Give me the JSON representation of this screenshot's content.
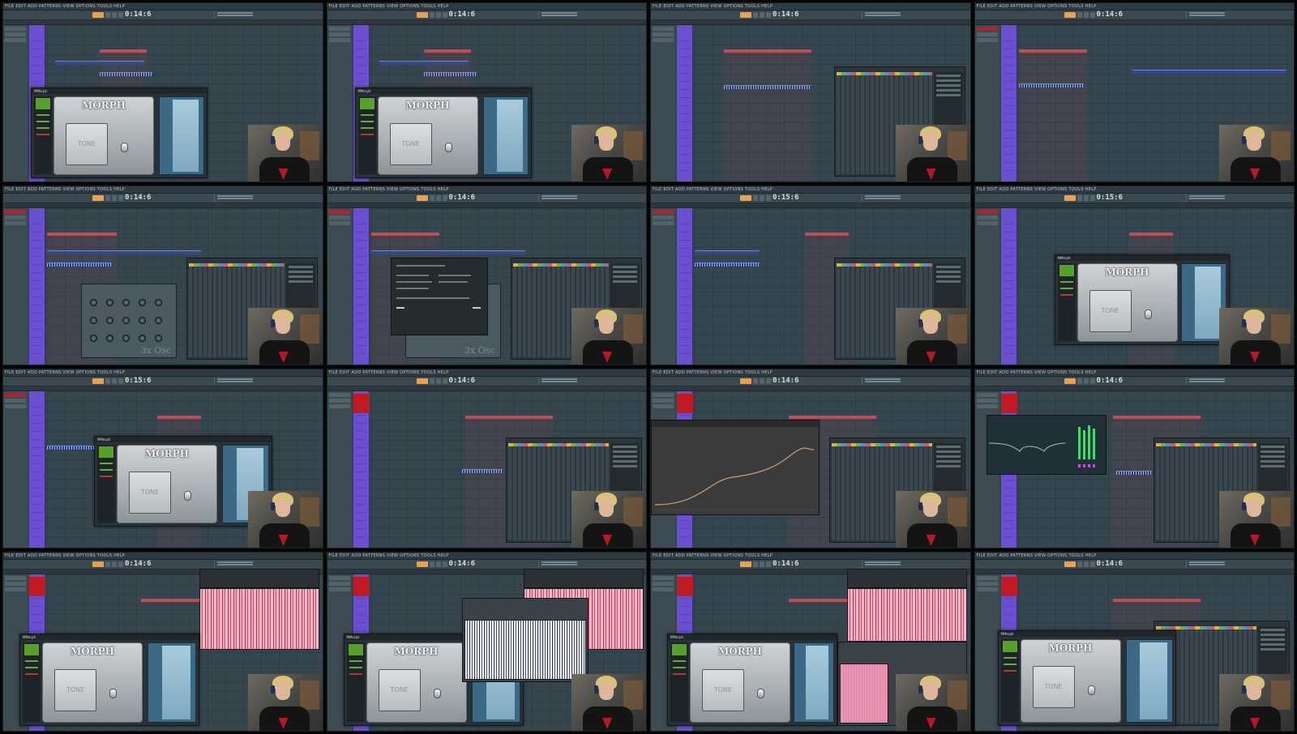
{
  "layout": "4x4 thumbnail contact sheet of an FL Studio session recording",
  "frames": [
    {
      "time": "0:14:6",
      "plugin_title": "MMorph",
      "plugin_logo": "MORPH",
      "tone": "TONE",
      "overlay": "morph"
    },
    {
      "time": "0:14:6",
      "plugin_title": "MMorph",
      "plugin_logo": "MORPH",
      "tone": "TONE",
      "overlay": "morph"
    },
    {
      "time": "0:14:6",
      "overlay": "mixer"
    },
    {
      "time": "0:14:6",
      "overlay": "none"
    },
    {
      "time": "0:14:6",
      "synth_name": "3x Osc",
      "overlay": "synth"
    },
    {
      "time": "0:14:6",
      "synth_name": "3x Osc",
      "overlay": "dialog"
    },
    {
      "time": "0:15:6",
      "overlay": "mixer"
    },
    {
      "time": "0:15:6",
      "plugin_title": "MMorph",
      "plugin_logo": "MORPH",
      "tone": "TONE",
      "overlay": "morph"
    },
    {
      "time": "0:15:6",
      "plugin_title": "MMorph",
      "plugin_logo": "MORPH",
      "tone": "TONE",
      "overlay": "morph"
    },
    {
      "time": "0:14:6",
      "overlay": "mixer"
    },
    {
      "time": "0:14:6",
      "overlay": "curve"
    },
    {
      "time": "0:14:6",
      "overlay": "eq"
    },
    {
      "time": "0:14:6",
      "plugin_title": "MMorph",
      "plugin_logo": "MORPH",
      "tone": "TONE",
      "overlay": "morph+wave"
    },
    {
      "time": "0:14:6",
      "plugin_title": "MMorph",
      "plugin_logo": "MORPH",
      "tone": "TONE",
      "overlay": "morph+wave2"
    },
    {
      "time": "0:14:6",
      "plugin_title": "MMorph",
      "plugin_logo": "MORPH",
      "tone": "TONE",
      "overlay": "morph+wave3"
    },
    {
      "time": "0:14:6",
      "plugin_title": "MMorph",
      "plugin_logo": "MORPH",
      "tone": "TONE",
      "overlay": "morph"
    }
  ],
  "menu_text": "FILE EDIT ADD PATTERNS VIEW OPTIONS TOOLS HELP",
  "colors": {
    "playlist_bg": "#36464f",
    "track_purple": "#6a4fd0",
    "track_red": "#c01a22",
    "tempo_orange": "#f0a044",
    "loop_marker": "#c24b58"
  }
}
